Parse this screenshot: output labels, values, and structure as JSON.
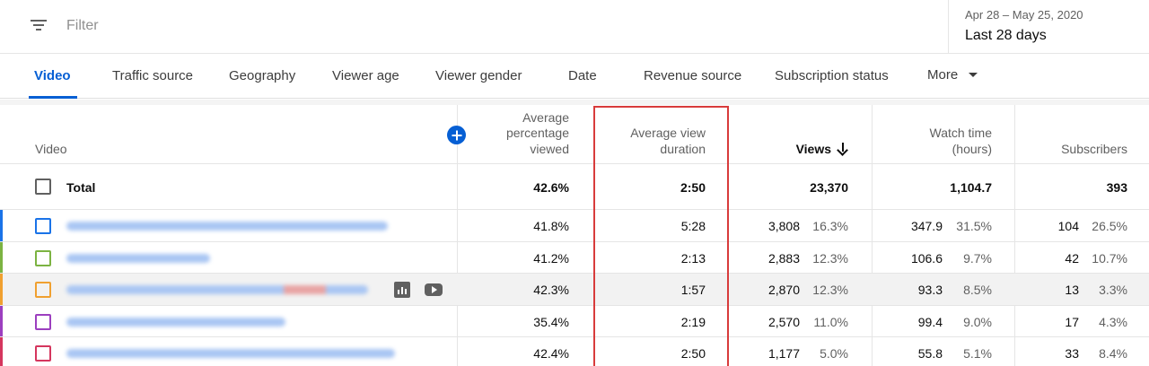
{
  "filter": {
    "placeholder": "Filter",
    "icon": "filter-icon"
  },
  "date": {
    "range": "Apr 28 – May 25, 2020",
    "label": "Last 28 days"
  },
  "tabs": [
    {
      "label": "Video",
      "active": true
    },
    {
      "label": "Traffic source"
    },
    {
      "label": "Geography"
    },
    {
      "label": "Viewer age"
    },
    {
      "label": "Viewer gender"
    },
    {
      "label": "Date"
    },
    {
      "label": "Revenue source"
    },
    {
      "label": "Subscription status"
    },
    {
      "label": "More"
    }
  ],
  "columns": {
    "video": "Video",
    "avg_pct": "Average percentage viewed",
    "avg_duration": "Average view duration",
    "views": "Views",
    "watch_time": "Watch time (hours)",
    "subscribers": "Subscribers"
  },
  "total": {
    "label": "Total",
    "avg_pct": "42.6%",
    "avg_duration": "2:50",
    "views": "23,370",
    "watch_time": "1,104.7",
    "subscribers": "393"
  },
  "rows": [
    {
      "color": "#1a73e8",
      "avg_pct": "41.8%",
      "avg_duration": "5:28",
      "views": "3,808",
      "views_pct": "16.3%",
      "watch_time": "347.9",
      "watch_pct": "31.5%",
      "subscribers": "104",
      "subs_pct": "26.5%"
    },
    {
      "color": "#7cb342",
      "avg_pct": "41.2%",
      "avg_duration": "2:13",
      "views": "2,883",
      "views_pct": "12.3%",
      "watch_time": "106.6",
      "watch_pct": "9.7%",
      "subscribers": "42",
      "subs_pct": "10.7%"
    },
    {
      "color": "#f0a030",
      "avg_pct": "42.3%",
      "avg_duration": "1:57",
      "views": "2,870",
      "views_pct": "12.3%",
      "watch_time": "93.3",
      "watch_pct": "8.5%",
      "subscribers": "13",
      "subs_pct": "3.3%"
    },
    {
      "color": "#9c3fbf",
      "avg_pct": "35.4%",
      "avg_duration": "2:19",
      "views": "2,570",
      "views_pct": "11.0%",
      "watch_time": "99.4",
      "watch_pct": "9.0%",
      "subscribers": "17",
      "subs_pct": "4.3%"
    },
    {
      "color": "#d5365e",
      "avg_pct": "42.4%",
      "avg_duration": "2:50",
      "views": "1,177",
      "views_pct": "5.0%",
      "watch_time": "55.8",
      "watch_pct": "5.1%",
      "subscribers": "33",
      "subs_pct": "8.4%"
    }
  ],
  "accent": "#065fd4",
  "highlight_color": "#d83b3b"
}
